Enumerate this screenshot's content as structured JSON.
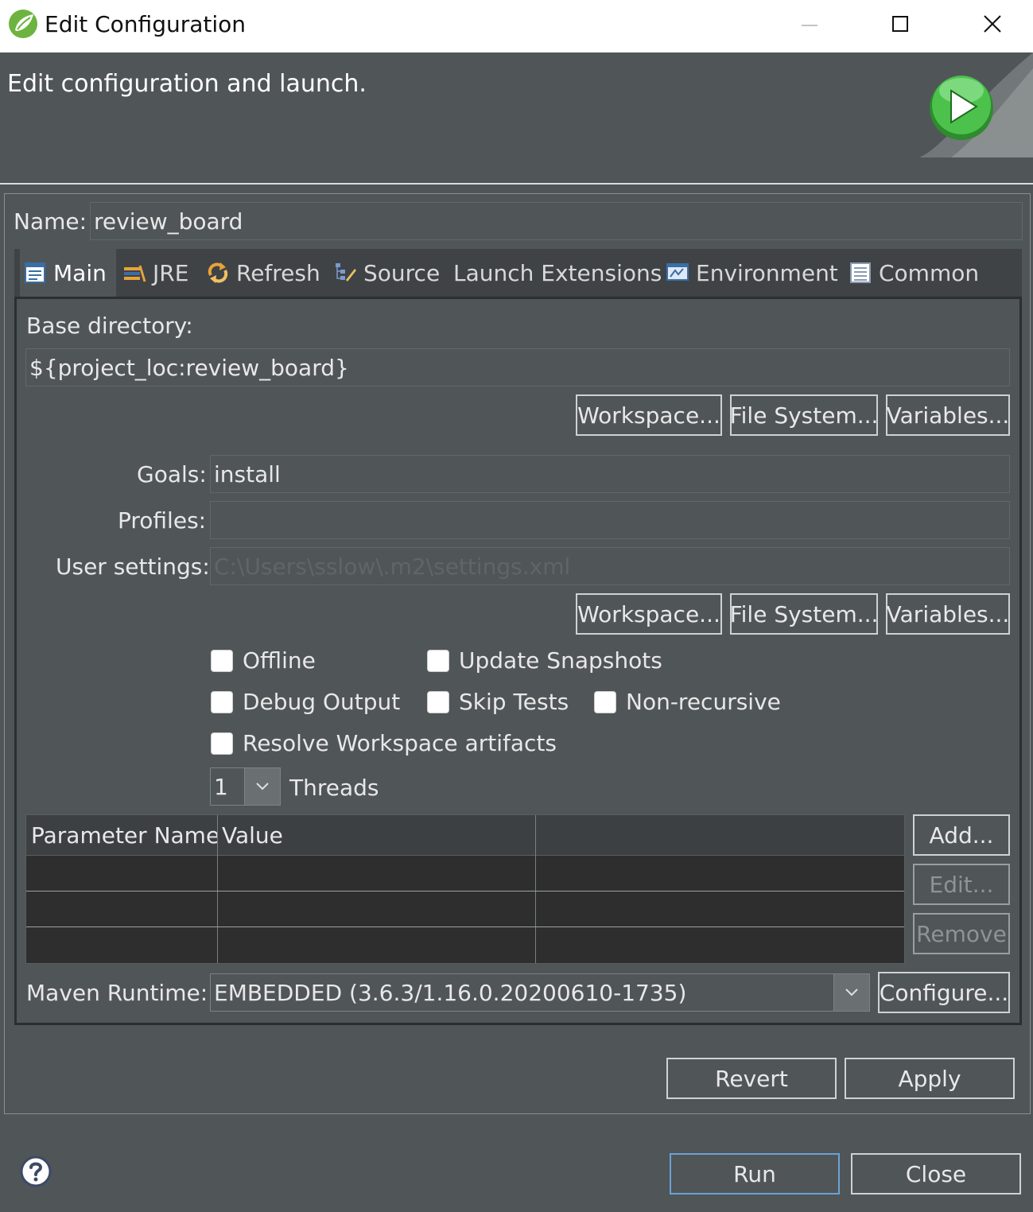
{
  "window": {
    "title": "Edit Configuration"
  },
  "header": {
    "title": "Edit configuration and launch."
  },
  "name": {
    "label": "Name:",
    "value": "review_board"
  },
  "tabs": [
    {
      "label": "Main",
      "icon": "main-tab-icon"
    },
    {
      "label": "JRE",
      "icon": "jre-tab-icon"
    },
    {
      "label": "Refresh",
      "icon": "refresh-tab-icon"
    },
    {
      "label": "Source",
      "icon": "source-tab-icon"
    },
    {
      "label": "Launch Extensions",
      "icon": ""
    },
    {
      "label": "Environment",
      "icon": "environment-tab-icon"
    },
    {
      "label": "Common",
      "icon": "common-tab-icon"
    }
  ],
  "base_dir": {
    "label": "Base directory:",
    "value": "${project_loc:review_board}",
    "buttons": {
      "workspace": "Workspace...",
      "file_system": "File System...",
      "variables": "Variables..."
    }
  },
  "goals": {
    "label": "Goals:",
    "value": "install"
  },
  "profiles": {
    "label": "Profiles:",
    "value": ""
  },
  "user_settings": {
    "label": "User settings:",
    "placeholder": "C:\\Users\\sslow\\.m2\\settings.xml",
    "buttons": {
      "workspace": "Workspace...",
      "file_system": "File System...",
      "variables": "Variables..."
    }
  },
  "options": {
    "offline": "Offline",
    "update_snapshots": "Update Snapshots",
    "debug_output": "Debug Output",
    "skip_tests": "Skip Tests",
    "non_recursive": "Non-recursive",
    "resolve_workspace": "Resolve Workspace artifacts"
  },
  "threads": {
    "value": "1",
    "label": "Threads"
  },
  "params": {
    "columns": [
      "Parameter Name",
      "Value",
      ""
    ],
    "rows": [
      [
        "",
        "",
        ""
      ],
      [
        "",
        "",
        ""
      ],
      [
        "",
        "",
        ""
      ]
    ],
    "buttons": {
      "add": "Add...",
      "edit": "Edit...",
      "remove": "Remove"
    }
  },
  "maven_runtime": {
    "label": "Maven Runtime:",
    "value": "EMBEDDED (3.6.3/1.16.0.20200610-1735)",
    "configure": "Configure..."
  },
  "actions": {
    "revert": "Revert",
    "apply": "Apply"
  },
  "footer": {
    "run": "Run",
    "close": "Close"
  }
}
